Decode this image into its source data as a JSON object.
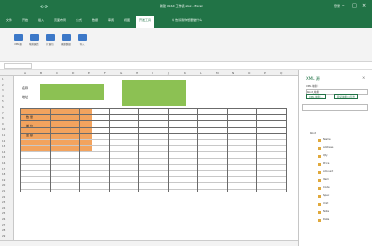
{
  "window": {
    "title": "新建 XLSX 工作表.xlsx - Excel",
    "account": "登录",
    "qat_label": "⟲ ⟳"
  },
  "menu_tabs": [
    "文件",
    "开始",
    "插入",
    "页面布局",
    "公式",
    "数据",
    "审阅",
    "视图",
    "开发工具",
    "♀ 告诉我你想要做什么"
  ],
  "active_tab_index": 7,
  "ribbon_buttons": [
    "XML源",
    "映射属性",
    "扩展包",
    "刷新数据",
    "导入"
  ],
  "columns": [
    "A",
    "B",
    "C",
    "D",
    "E",
    "F",
    "G",
    "H",
    "I",
    "J",
    "K",
    "L",
    "M",
    "N",
    "O",
    "P",
    "Q"
  ],
  "rows": [
    "1",
    "2",
    "3",
    "4",
    "5",
    "6",
    "7",
    "8",
    "9",
    "10",
    "11",
    "12",
    "13",
    "14",
    "15",
    "16",
    "17",
    "18",
    "19",
    "20",
    "21",
    "22",
    "23",
    "24",
    "25",
    "26",
    "27",
    "28",
    "29"
  ],
  "cells": {
    "b2": "名称",
    "b4": "地址",
    "b7": "数 量",
    "b9": "单 价",
    "b11": "金 额"
  },
  "xml_pane": {
    "title": "XML 源",
    "subtitle": "XML 映射:",
    "map_name": "Root_映射",
    "btn_map": "XML 映射...",
    "btn_verify": "验证映射以导出",
    "search_placeholder": "",
    "tree_root": "Root",
    "tree_items": [
      "Name",
      "Address",
      "Qty",
      "Price",
      "Amount",
      "Item",
      "Code",
      "Spec",
      "Unit",
      "Note",
      "Date"
    ]
  },
  "colors": {
    "excel_green": "#217346",
    "fill_green": "#8cc153",
    "fill_orange": "#f2a35e"
  }
}
